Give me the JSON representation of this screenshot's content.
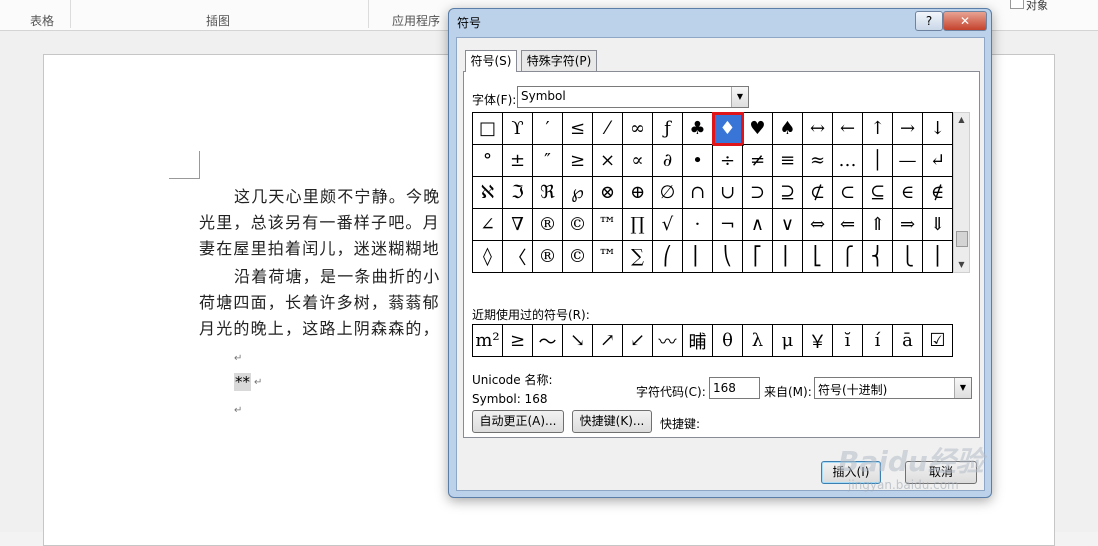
{
  "ribbon": {
    "groups": [
      "表格",
      "插图",
      "应用程序"
    ],
    "top_right_text": "对象"
  },
  "document": {
    "paragraphs": [
      "这几天心里颇不宁静。今晚",
      "光里，总该另有一番样子吧。月",
      "妻在屋里拍着闰儿，迷迷糊糊地",
      "沿着荷塘，是一条曲折的小",
      "荷塘四面，长着许多树，蓊蓊郁",
      "月光的晚上，这路上阴森森的，"
    ],
    "para_mark": "↵",
    "star_text": "**"
  },
  "dialog": {
    "title": "符号",
    "help_label": "?",
    "close_label": "✕",
    "tabs": [
      "符号(S)",
      "特殊字符(P)"
    ],
    "font_label": "字体(F):",
    "font_value": "Symbol",
    "grid": [
      [
        "□",
        "ϒ",
        "′",
        "≤",
        "⁄",
        "∞",
        "ƒ",
        "♣",
        "♦",
        "♥",
        "♠",
        "↔",
        "←",
        "↑",
        "→",
        "↓"
      ],
      [
        "°",
        "±",
        "″",
        "≥",
        "×",
        "∝",
        "∂",
        "•",
        "÷",
        "≠",
        "≡",
        "≈",
        "…",
        "│",
        "—",
        "↵"
      ],
      [
        "ℵ",
        "ℑ",
        "ℜ",
        "℘",
        "⊗",
        "⊕",
        "∅",
        "∩",
        "∪",
        "⊃",
        "⊇",
        "⊄",
        "⊂",
        "⊆",
        "∈",
        "∉"
      ],
      [
        "∠",
        "∇",
        "®",
        "©",
        "™",
        "∏",
        "√",
        "⋅",
        "¬",
        "∧",
        "∨",
        "⇔",
        "⇐",
        "⇑",
        "⇒",
        "⇓"
      ],
      [
        "◊",
        "〈",
        "®",
        "©",
        "™",
        "∑",
        "⎛",
        "⎜",
        "⎝",
        "⎡",
        "⎢",
        "⎣",
        "⎧",
        "⎨",
        "⎩",
        "⎪"
      ]
    ],
    "selected_symbol": "♦",
    "recent_label": "近期使用过的符号(R):",
    "recent": [
      "m²",
      "≥",
      "～",
      "↘",
      "↗",
      "↙",
      "〰",
      "晡",
      "θ",
      "λ",
      "μ",
      "￥",
      "ĭ",
      "í",
      "ā",
      "☑"
    ],
    "unicode_name_label": "Unicode 名称:",
    "unicode_name_value": "Symbol: 168",
    "char_code_label": "字符代码(C):",
    "char_code_value": "168",
    "from_label": "来自(M):",
    "from_value": "符号(十进制)",
    "autocorrect_label": "自动更正(A)...",
    "shortcut_key_label": "快捷键(K)...",
    "shortcut_text": "快捷键:",
    "insert_label": "插入(I)",
    "cancel_label": "取消"
  },
  "watermark": {
    "text": "Baidu经验",
    "sub": "jingyan.baidu.com"
  }
}
